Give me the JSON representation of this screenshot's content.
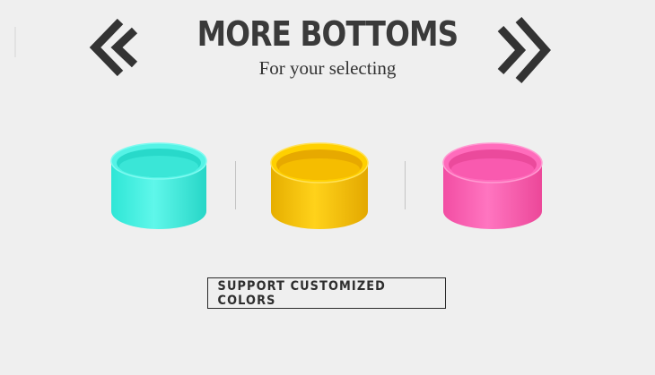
{
  "banner": {
    "title": "MORE BOTTOMS",
    "subtitle": "For your selecting",
    "cta_label": "SUPPORT CUSTOMIZED COLORS"
  },
  "nav": {
    "prev_icon": "double-chevron-left-icon",
    "next_icon": "double-chevron-right-icon"
  },
  "products": [
    {
      "color": "#3ff0e0",
      "name": "cyan"
    },
    {
      "color": "#f8c400",
      "name": "yellow"
    },
    {
      "color": "#ff63b6",
      "name": "pink"
    }
  ],
  "colors": {
    "text": "#3a3a3a",
    "background": "#efefef"
  }
}
